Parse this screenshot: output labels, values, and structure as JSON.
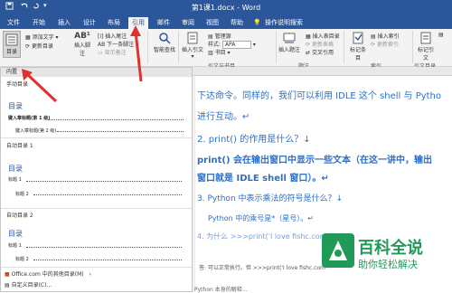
{
  "titlebar": {
    "title": "第1课1.docx  -  Word",
    "save_icon": "save-icon",
    "undo_icon": "undo-icon",
    "redo_icon": "redo-icon"
  },
  "tabs": [
    "文件",
    "开始",
    "插入",
    "设计",
    "布局",
    "引用",
    "邮件",
    "审阅",
    "视图",
    "帮助",
    "操作说明搜索"
  ],
  "active_tab": "引用",
  "ribbon": {
    "toc_button": "目录",
    "add_text": "添加文字",
    "update_toc": "更新目录",
    "insert_footnote": "插入脚注",
    "insert_endnote": "插入尾注",
    "next_footnote": "下一条脚注",
    "show_notes": "显示备注",
    "smart_lookup": "智能查找",
    "insert_citation": "插入引文",
    "manage_sources": "管理源",
    "style_label": "样式:",
    "style_value": "APA",
    "bibliography": "书目",
    "insert_caption": "插入题注",
    "insert_table_of_figures": "插入表目录",
    "update_table": "更新表格",
    "cross_reference": "交叉引用",
    "mark_entry": "标记条目",
    "insert_index": "插入索引",
    "update_index": "更新索引",
    "mark_citation": "标记引文",
    "group_citations": "引文与书目",
    "group_captions": "题注",
    "group_index": "索引",
    "group_toa": "引文目录"
  },
  "toc_panel": {
    "section_builtin": "内置",
    "manual_label": "手动目录",
    "manual_heading": "目录",
    "manual_line1": "键入章标题(第 1 级)",
    "manual_line2": "键入章标题(第 2 级)",
    "auto1_label": "自动目录 1",
    "auto1_heading": "目录",
    "auto1_line1": "标题 1",
    "auto1_line2": "标题 2",
    "auto2_label": "自动目录 2",
    "auto2_heading": "目录",
    "auto2_line1": "标题 1",
    "auto2_line2": "标题 2",
    "office_more": "Office.com 中的其他目录(M)",
    "custom_toc": "自定义目录(C)..."
  },
  "document": {
    "line1": "下达命令。同样的，我们可以利用 IDLE 这个 shell 与 Pytho",
    "line2": "进行互动。↵",
    "line3": "2. print()  的作用是什么？↓",
    "line4": "print()  会在输出窗口中显示一些文本（在这一讲中，输出",
    "line5": "窗口就是 IDLE shell 窗口）。↵",
    "line6": "3. Python  中表示乘法的符号是什么？↓",
    "line7": "Python 中的乘号是*（星号）。↵",
    "line8": "4. 为什么  >>>print('I love fishc.com",
    "line9": "答: 可以正常执行。但  >>>print('I love fishc.com",
    "line10": "Python 本身的解释…"
  },
  "watermark": {
    "title": "百科全说",
    "subtitle": "助你轻松解决"
  },
  "colors": {
    "accent": "#2b579a",
    "red": "#e03030",
    "doc_text": "#2e6fc5"
  }
}
